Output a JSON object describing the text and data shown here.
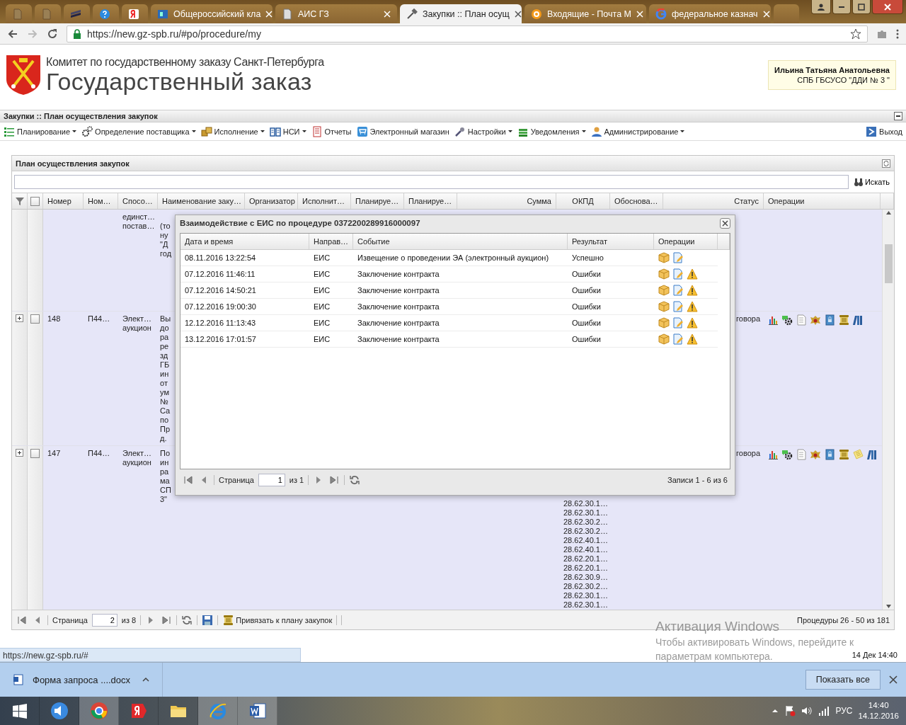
{
  "browser": {
    "tabs": [
      {
        "label": "Общероссийский кла",
        "selected": false
      },
      {
        "label": "АИС ГЗ",
        "selected": false
      },
      {
        "label": "Закупки :: План осущ",
        "selected": true
      },
      {
        "label": "Входящие - Почта М",
        "selected": false
      },
      {
        "label": "федеральное казнач",
        "selected": false
      }
    ],
    "url": "https://new.gz-spb.ru/#po/procedure/my"
  },
  "header": {
    "committee": "Комитет по государственному заказу Санкт-Петербурга",
    "title": "Государственный заказ",
    "user_name": "Ильина Татьяна Анатольевна",
    "user_org": "СПБ ГБСУСО \"ДДИ № 3 \""
  },
  "app_title": "Закупки :: План осуществления закупок",
  "menu": [
    {
      "label": "Планирование",
      "dropdown": true
    },
    {
      "label": "Определение поставщика",
      "dropdown": true
    },
    {
      "label": "Исполнение",
      "dropdown": true
    },
    {
      "label": "НСИ",
      "dropdown": true
    },
    {
      "label": "Отчеты",
      "dropdown": false
    },
    {
      "label": "Электронный магазин",
      "dropdown": false
    },
    {
      "label": "Настройки",
      "dropdown": true
    },
    {
      "label": "Уведомления",
      "dropdown": true
    },
    {
      "label": "Администрирование",
      "dropdown": true
    }
  ],
  "exit": "Выход",
  "plan_panel": {
    "title": "План осуществления закупок",
    "search_button": "Искать",
    "header_checked": false,
    "columns": [
      "Номер",
      "Ном…",
      "Спосо…",
      "Наименование заку…",
      "Организатор",
      "Исполнит…",
      "Планируе…",
      "Планируе…",
      "Сумма",
      "ОКПД",
      "Обоснова…",
      "Статус",
      "Операции"
    ],
    "cut_row": {
      "method": [
        "единст…",
        "постав…"
      ],
      "name": [
        "(то",
        "ну",
        "\"Д",
        "год"
      ]
    },
    "rows": [
      {
        "expanded": false,
        "checked": false,
        "number": "148",
        "col_2": "П44…",
        "method": [
          "Элект…",
          "аукцион"
        ],
        "name": [
          "Вы",
          "до",
          "ра",
          "ре",
          "зд",
          "ГБ",
          "ин",
          "от",
          "ум",
          "№",
          "Са",
          "по",
          "Пр",
          "д."
        ],
        "okpd": [],
        "status": "говора",
        "note": false
      },
      {
        "expanded": false,
        "checked": false,
        "number": "147",
        "col_2": "П44…",
        "method": [
          "Элект…",
          "аукцион"
        ],
        "name": [
          "По",
          "ин",
          "ра",
          "ма",
          "СП",
          "3\""
        ],
        "okpd": [
          "28.62.30.1…",
          "28.62.30.1…",
          "28.62.30.2…",
          "28.62.30.2…",
          "28.62.40.1…",
          "28.62.40.1…",
          "28.62.20.1…",
          "28.62.20.1…",
          "28.62.30.9…",
          "28.62.30.2…",
          "28.62.30.1…",
          "28.62.30.1…"
        ],
        "status": "говора",
        "note": true
      }
    ],
    "pager": {
      "page_label": "Страница",
      "page": "2",
      "of": "из 8",
      "link_button": "Привязать к плану закупок",
      "summary": "Процедуры 26 - 50 из 181"
    }
  },
  "dialog": {
    "title": "Взаимодействие с ЕИС по процедуре 0372200289916000097",
    "columns": [
      "Дата и время",
      "Направ…",
      "Событие",
      "Результат",
      "Операции"
    ],
    "rows": [
      {
        "datetime": "08.11.2016 13:22:54",
        "direction": "ЕИС",
        "event": "Извещение о проведении ЭА (электронный аукцион)",
        "result": "Успешно",
        "warning": false
      },
      {
        "datetime": "07.12.2016 11:46:11",
        "direction": "ЕИС",
        "event": "Заключение контракта",
        "result": "Ошибки",
        "warning": true
      },
      {
        "datetime": "07.12.2016 14:50:21",
        "direction": "ЕИС",
        "event": "Заключение контракта",
        "result": "Ошибки",
        "warning": true
      },
      {
        "datetime": "07.12.2016 19:00:30",
        "direction": "ЕИС",
        "event": "Заключение контракта",
        "result": "Ошибки",
        "warning": true
      },
      {
        "datetime": "12.12.2016 11:13:43",
        "direction": "ЕИС",
        "event": "Заключение контракта",
        "result": "Ошибки",
        "warning": true
      },
      {
        "datetime": "13.12.2016 17:01:57",
        "direction": "ЕИС",
        "event": "Заключение контракта",
        "result": "Ошибки",
        "warning": true
      }
    ],
    "pager": {
      "page_label": "Страница",
      "page": "1",
      "of": "из 1",
      "summary": "Записи 1 - 6 из 6"
    }
  },
  "status_url": "https://new.gz-spb.ru/#",
  "status_time": "14 Дек 14:40",
  "watermark": {
    "title": "Активация Windows",
    "line_1": "Чтобы активировать Windows, перейдите к",
    "line_2": "параметрам компьютера."
  },
  "download": {
    "file": "Форма запроса ....docx",
    "show_all": "Показать все"
  },
  "taskbar": {
    "language": "РУС",
    "time": "14:40",
    "date": "14.12.2016"
  }
}
